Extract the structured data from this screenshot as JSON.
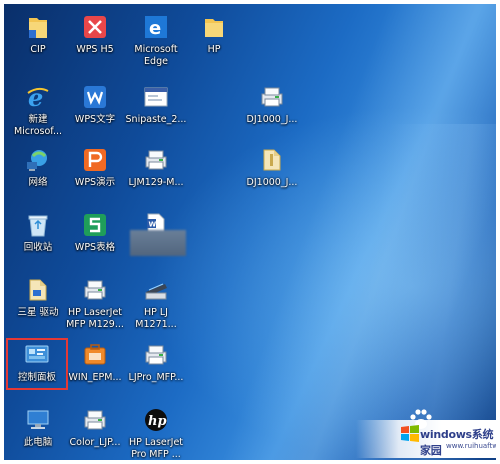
{
  "desktop": {
    "icons": [
      {
        "label": "CIP",
        "icon": "folder-icon"
      },
      {
        "label": "WPS H5",
        "icon": "wps-h5-icon"
      },
      {
        "label": "Microsoft\nEdge",
        "icon": "edge-icon"
      },
      {
        "label": "HP",
        "icon": "folder-icon"
      },
      {
        "label": "新建\nMicrosof...",
        "icon": "ie-icon"
      },
      {
        "label": "WPS文字",
        "icon": "wps-writer-icon"
      },
      {
        "label": "Snipaste_2...",
        "icon": "image-file-icon"
      },
      {
        "label": "DJ1000_J...",
        "icon": "printer-icon"
      },
      {
        "label": "网络",
        "icon": "network-icon"
      },
      {
        "label": "WPS演示",
        "icon": "wps-presentation-icon"
      },
      {
        "label": "LJM129-M...",
        "icon": "printer-icon"
      },
      {
        "label": "DJ1000_J...",
        "icon": "folder-zip-icon"
      },
      {
        "label": "回收站",
        "icon": "recycle-bin-icon"
      },
      {
        "label": "WPS表格",
        "icon": "wps-spreadsheet-icon"
      },
      {
        "label": "",
        "icon": "word-document-icon"
      },
      {
        "label": "三星 驱动",
        "icon": "folder-icon"
      },
      {
        "label": "HP LaserJet\nMFP M129...",
        "icon": "printer-icon"
      },
      {
        "label": "HP LJ\nM1271...",
        "icon": "scanner-icon"
      },
      {
        "label": "控制面板",
        "icon": "control-panel-icon"
      },
      {
        "label": "WIN_EPM...",
        "icon": "toolbox-icon"
      },
      {
        "label": "LJPro_MFP...",
        "icon": "printer-icon"
      },
      {
        "label": "此电脑",
        "icon": "computer-icon"
      },
      {
        "label": "Color_LJP...",
        "icon": "printer-icon"
      },
      {
        "label": "HP LaserJet\nPro MFP ...",
        "icon": "hp-logo-icon"
      }
    ],
    "selected_label": "控制面板"
  },
  "watermark": {
    "text": "windows系统家园",
    "sub": "www.ruihuaftw.com"
  },
  "colors": {
    "selection": "#e53935",
    "label": "#ffffff"
  }
}
